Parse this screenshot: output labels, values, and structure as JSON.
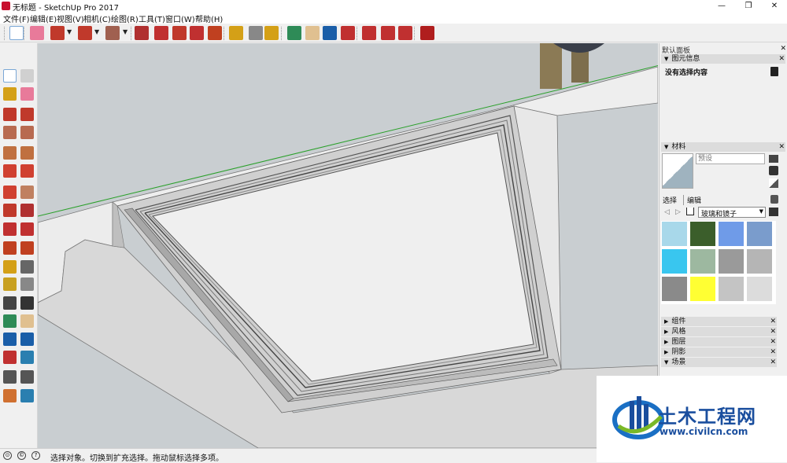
{
  "window": {
    "title": "无标题 - SketchUp Pro 2017",
    "buttons": [
      "—",
      "❐",
      "✕"
    ]
  },
  "menu": [
    "文件(F)",
    "编辑(E)",
    "视图(V)",
    "相机(C)",
    "绘图(R)",
    "工具(T)",
    "窗口(W)",
    "帮助(H)"
  ],
  "top_toolbar": [
    {
      "icon": "select-arrow-icon",
      "color": "#2a2a2a"
    },
    {
      "icon": "eraser-icon",
      "color": "#e87a9a"
    },
    {
      "icon": "pencil-line-icon",
      "color": "#c0392b"
    },
    {
      "icon": "arc-icon",
      "color": "#c0392b"
    },
    {
      "icon": "rectangle-shape-icon",
      "color": "#a06050"
    },
    {
      "icon": "push-pull-icon",
      "color": "#b03030"
    },
    {
      "icon": "follow-me-icon",
      "color": "#c03030"
    },
    {
      "icon": "move-icon",
      "color": "#c0392b"
    },
    {
      "icon": "rotate-icon",
      "color": "#c03030"
    },
    {
      "icon": "scale-icon",
      "color": "#c04020"
    },
    {
      "icon": "tape-measure-icon",
      "color": "#d4a017"
    },
    {
      "icon": "text-label-icon",
      "color": "#888888"
    },
    {
      "icon": "paint-bucket-icon",
      "color": "#d4a017"
    },
    {
      "icon": "orbit-icon",
      "color": "#2e8b57"
    },
    {
      "icon": "pan-hand-icon",
      "color": "#e0c090"
    },
    {
      "icon": "zoom-icon",
      "color": "#1a5ea8"
    },
    {
      "icon": "zoom-extents-icon",
      "color": "#c03030"
    },
    {
      "icon": "warehouse-icon",
      "color": "#c03030"
    },
    {
      "icon": "extension-warehouse-icon",
      "color": "#c03030"
    },
    {
      "icon": "send-to-layout-icon",
      "color": "#c03030"
    },
    {
      "icon": "ruby-icon",
      "color": "#b01e1e"
    }
  ],
  "left_toolbar": [
    "select-icon",
    "make-component-icon",
    "paint-bucket-icon",
    "eraser-icon",
    "line-icon",
    "freehand-icon",
    "rectangle-icon",
    "rotated-rectangle-icon",
    "circle-icon",
    "polygon-icon",
    "arc-icon",
    "two-point-arc-icon",
    "three-point-arc-icon",
    "pie-icon",
    "move-icon",
    "push-pull-icon",
    "rotate-icon",
    "follow-me-icon",
    "scale-icon",
    "offset-icon",
    "tape-measure-icon",
    "dimension-icon",
    "protractor-icon",
    "text-icon",
    "axes-icon",
    "3d-text-icon",
    "orbit-icon",
    "pan-icon",
    "zoom-icon",
    "zoom-window-icon",
    "zoom-extents-icon",
    "position-camera-icon",
    "walk-icon",
    "look-around-icon",
    "section-plane-icon",
    "section-display-icon"
  ],
  "panel": {
    "title": "默认面板",
    "entity_info": {
      "header": "图元信息",
      "content": "没有选择内容"
    },
    "materials": {
      "header": "材料",
      "name_placeholder": "预设",
      "tabs": [
        "选择",
        "编辑"
      ],
      "collection": "玻璃和镜子",
      "swatches": [
        {
          "color": "#a8d8ea"
        },
        {
          "color": "#3b5e2b"
        },
        {
          "color": "#6f9be8"
        },
        {
          "color": "#7a9ccc"
        },
        {
          "color": "#39c6ef"
        },
        {
          "color": "#9db8a0"
        },
        {
          "color": "#9a9a9a"
        },
        {
          "color": "#b5b5b5"
        },
        {
          "color": "#8a8a8a"
        },
        {
          "color": "#ffff33"
        },
        {
          "color": "#c4c4c4"
        },
        {
          "color": "#dcdcdc"
        }
      ]
    },
    "collapsed": [
      "组件",
      "风格",
      "图层",
      "阴影",
      "场景"
    ]
  },
  "status": {
    "text": "选择对象。切换到扩充选择。拖动鼠标选择多项。"
  },
  "watermark": {
    "brand": "土木工程网",
    "url": "www.civilcn.com"
  }
}
